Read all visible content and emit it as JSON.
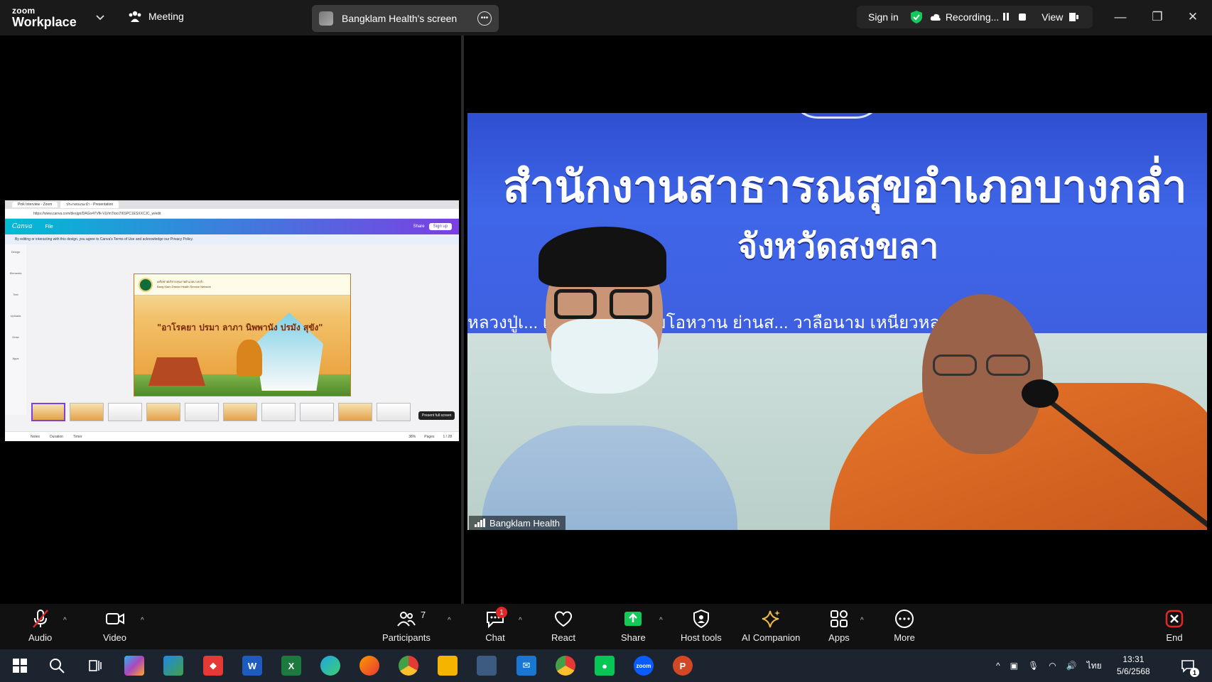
{
  "topbar": {
    "brand_line1": "zoom",
    "brand_line2": "Workplace",
    "meeting_label": "Meeting",
    "share_title": "Bangklam Health's screen",
    "sign_in": "Sign in",
    "recording_label": "Recording...",
    "view_label": "View"
  },
  "shared_screen": {
    "browser_tabs": [
      "Pink Interview - Zoom",
      "ประกอบแนะนำ - Presentation"
    ],
    "url": "https://www.canva.com/design/DAGo4YVfk-VU/mTtoci7I6SPC1ESXXCJC_w/edit",
    "canva_logo": "Canva",
    "file_menu": "File",
    "share_btn": "Share",
    "signup_btn": "Sign up",
    "notice": "By editing or interacting with this design, you agree to Canva's Terms of Use and acknowledge our Privacy Policy.",
    "side_items": [
      "Design",
      "Elements",
      "Text",
      "Uploads",
      "Draw",
      "Apps"
    ],
    "slide_header": "เครือข่ายบริการสุขภาพอำเภอบางกล่ำ\nBang Klam District Health Service Network",
    "slide_title": "\"อาโรคยา ปรมา ลาภา นิพพานัง ปรมัง สุขัง\"",
    "tooltip": "Present full screen",
    "footer_notes": "Notes",
    "footer_duration": "Duration",
    "footer_timer": "Timer",
    "footer_zoom": "38%",
    "footer_pages": "Pages",
    "footer_pagecount": "1 / 28"
  },
  "video": {
    "banner_line1": "สำนักงานสาธารณสุขอำเภอบางกล่ำ",
    "banner_line2": "จังหวัดสงขลา",
    "banner_line3": "หลวงปู่เ...   เรือแข่ง  แหล่งส้มโอหวาน  ย่านส...  วาลือนาม  เหนียวหลาบรสดี",
    "participant_name": "Bangklam Health"
  },
  "toolbar": {
    "audio": "Audio",
    "video": "Video",
    "participants": "Participants",
    "participants_count": "7",
    "chat": "Chat",
    "chat_badge": "1",
    "react": "React",
    "share": "Share",
    "host_tools": "Host tools",
    "ai_companion": "AI Companion",
    "apps": "Apps",
    "more": "More",
    "end": "End"
  },
  "taskbar": {
    "lang": "ไทย",
    "time": "13:31",
    "date": "5/6/2568",
    "notif_count": "1"
  },
  "colors": {
    "share_green": "#14c95a",
    "end_red": "#e02828",
    "canva_gradient_start": "#00bcd4",
    "canva_gradient_end": "#7b3fe4",
    "banner_blue": "#3f66e8"
  }
}
